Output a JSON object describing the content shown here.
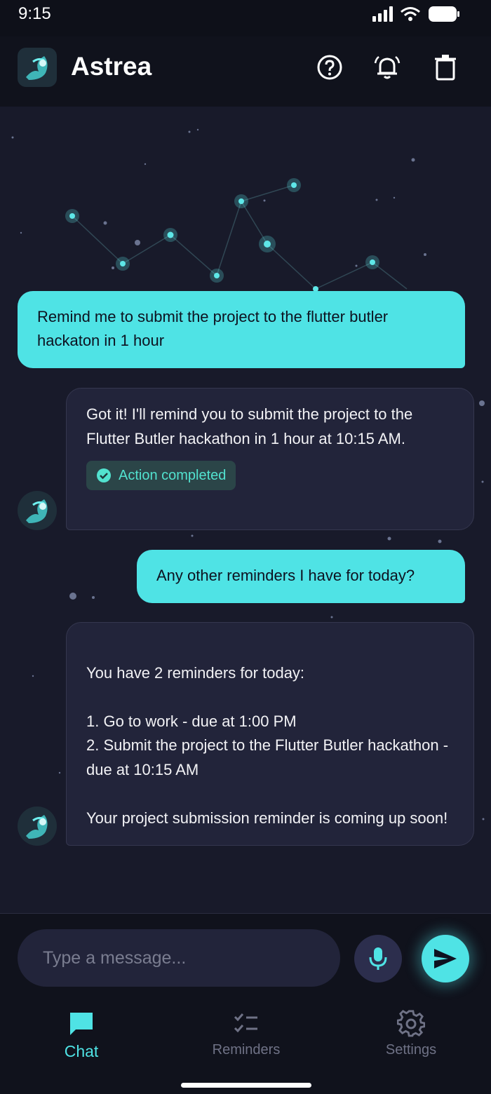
{
  "status_bar": {
    "time": "9:15"
  },
  "app_bar": {
    "title": "Astrea",
    "actions": [
      "help-icon",
      "bell-icon",
      "trash-icon"
    ]
  },
  "chat": {
    "messages": [
      {
        "role": "user",
        "text": "Remind me to submit the project to the flutter butler hackaton in 1 hour"
      },
      {
        "role": "assistant",
        "text": "Got it! I'll remind you to submit the project to the Flutter Butler hackathon in 1 hour at 10:15 AM.",
        "badge": "Action completed"
      },
      {
        "role": "user",
        "text": "Any other reminders I have for today?"
      },
      {
        "role": "assistant",
        "text": "You have 2 reminders for today:\n\n1. Go to work - due at 1:00 PM\n2. Submit the project to the Flutter Butler hackathon - due at 10:15 AM\n\nYour project submission reminder is coming up soon!"
      }
    ]
  },
  "composer": {
    "placeholder": "Type a message..."
  },
  "nav": {
    "items": [
      {
        "label": "Chat",
        "icon": "chat-bubble-icon",
        "active": true
      },
      {
        "label": "Reminders",
        "icon": "checklist-icon",
        "active": false
      },
      {
        "label": "Settings",
        "icon": "gear-icon",
        "active": false
      }
    ]
  },
  "colors": {
    "accent": "#4fe3e5",
    "background": "#181a2a",
    "bubble_bot": "#22243a",
    "success": "#52e2cf"
  }
}
